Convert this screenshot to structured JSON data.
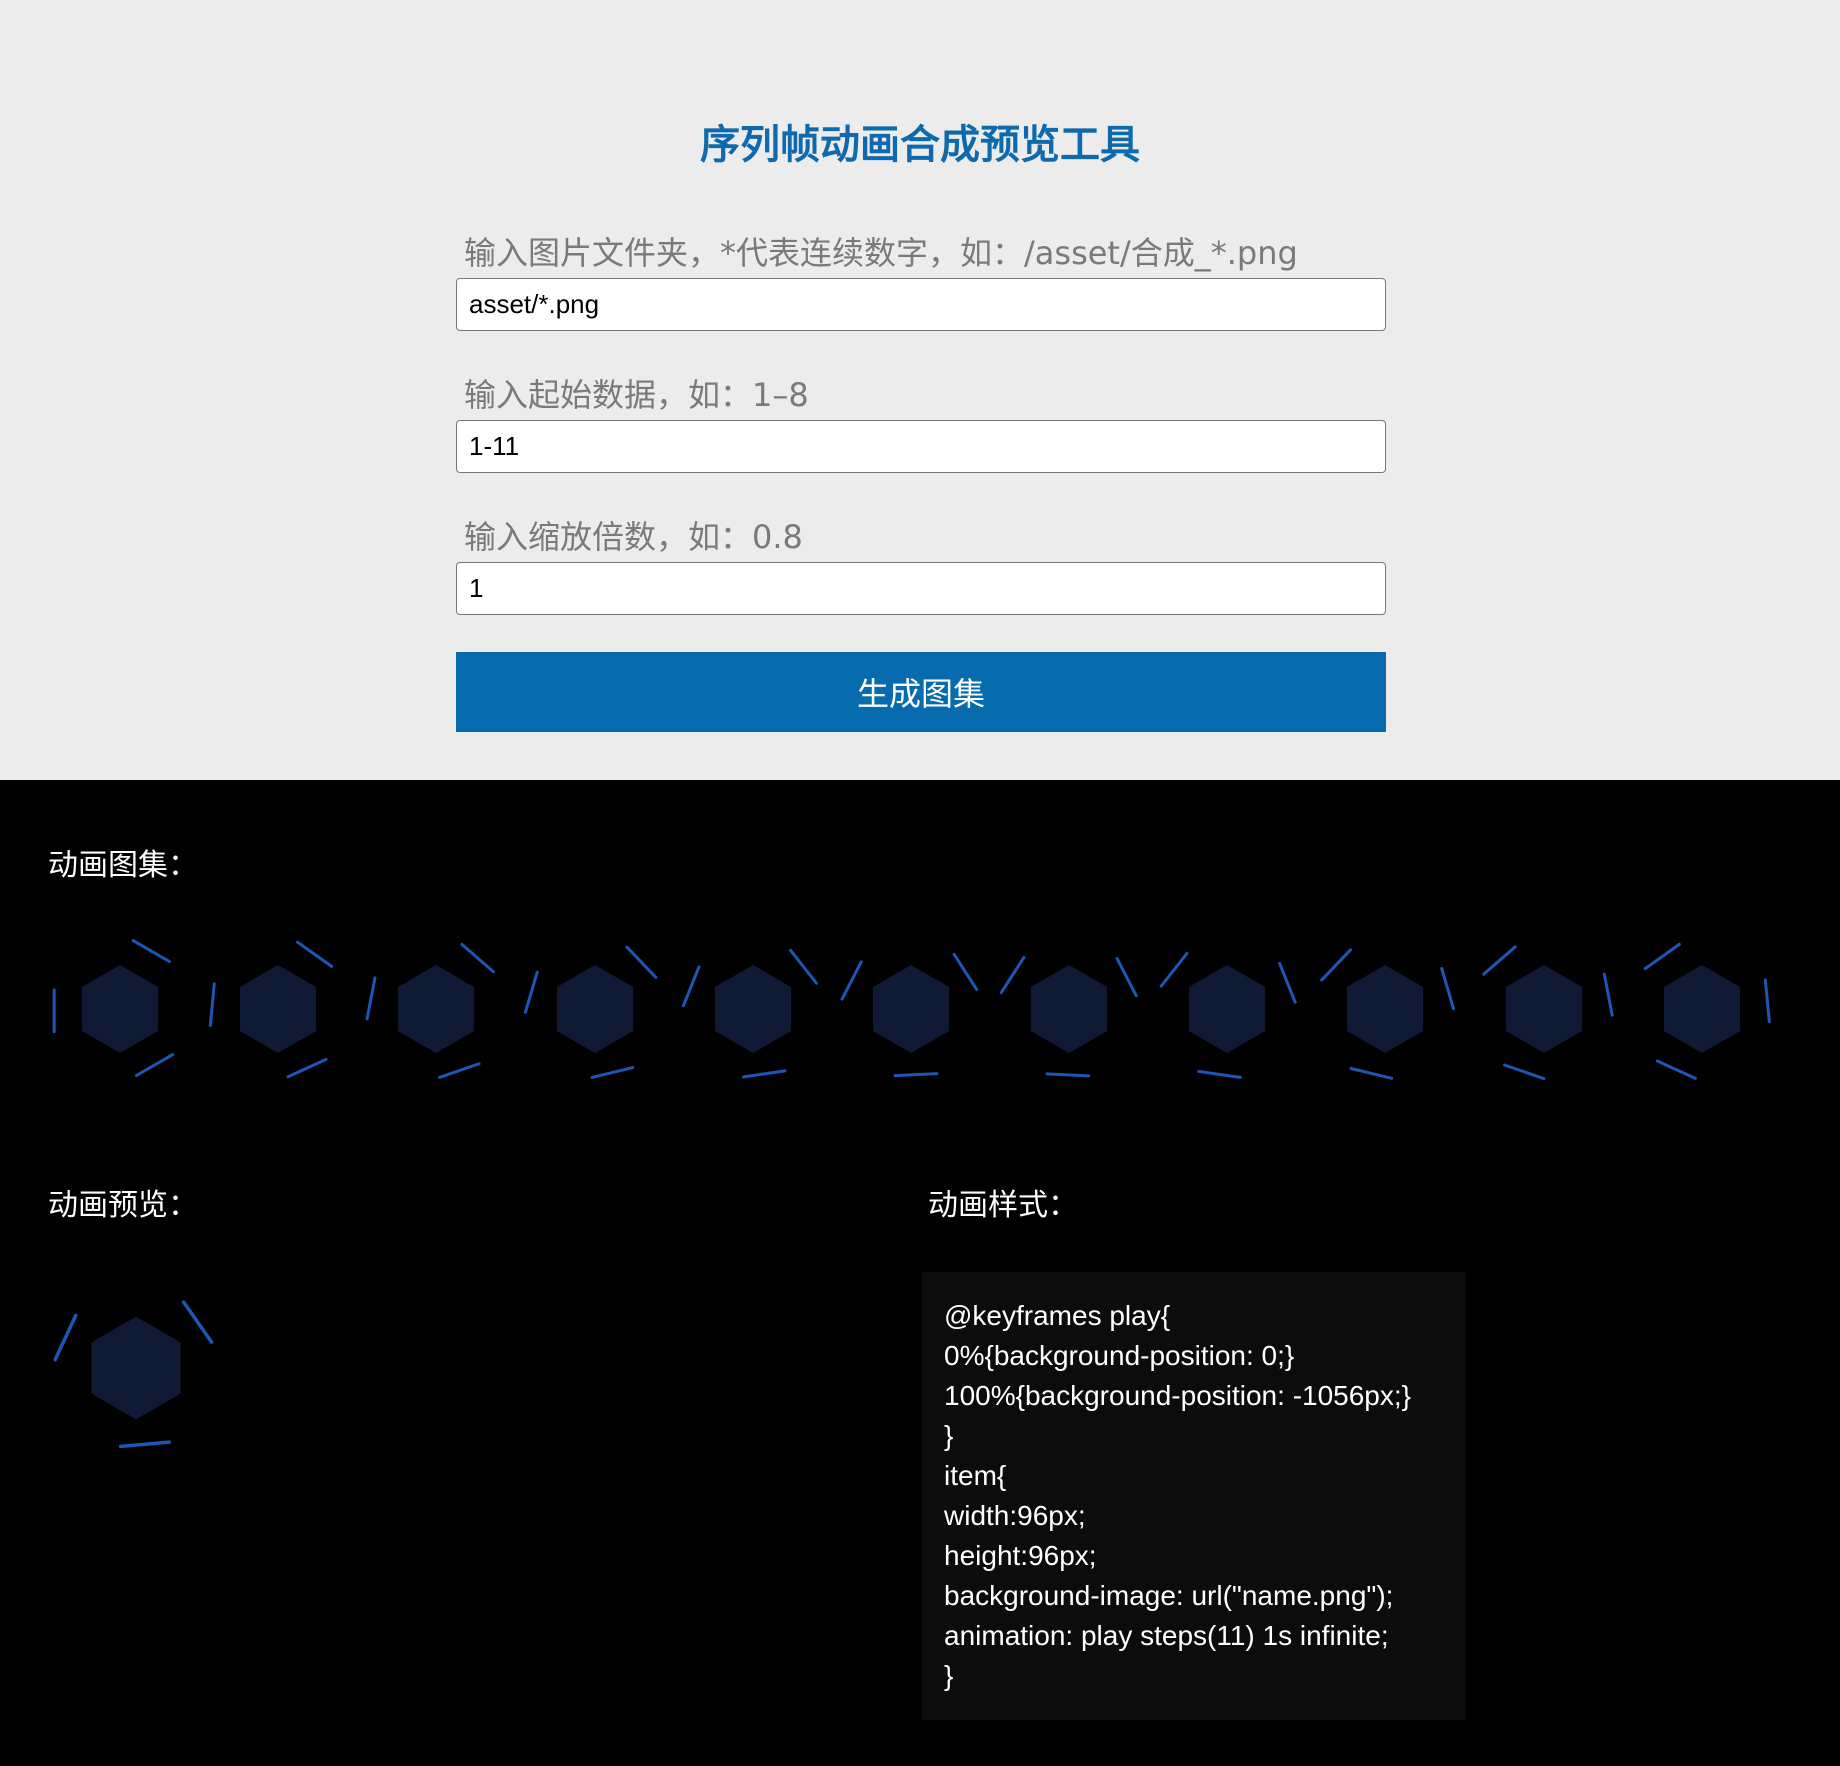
{
  "title": "序列帧动画合成预览工具",
  "fields": [
    {
      "label": "输入图片文件夹，*代表连续数字，如：/asset/合成_*.png",
      "value": "asset/*.png"
    },
    {
      "label": "输入起始数据，如：1–8",
      "value": "1-11"
    },
    {
      "label": "输入缩放倍数，如：0.8",
      "value": "1"
    }
  ],
  "generate_button": "生成图集",
  "atlas_label": "动画图集：",
  "preview_label": "动画预览：",
  "style_label": "动画样式：",
  "frame_count": 11,
  "colors": {
    "accent": "#066cad",
    "title": "#0e6aad",
    "hex_fill": "#111a35",
    "hex_stroke": "#1f55b5"
  },
  "code_lines": [
    "@keyframes play{",
    "0%{background-position: 0;}",
    "100%{background-position: -1056px;}",
    "}",
    "item{",
    "width:96px;",
    "height:96px;",
    "background-image: url(\"name.png\");",
    "animation: play steps(11) 1s infinite;",
    "}"
  ]
}
